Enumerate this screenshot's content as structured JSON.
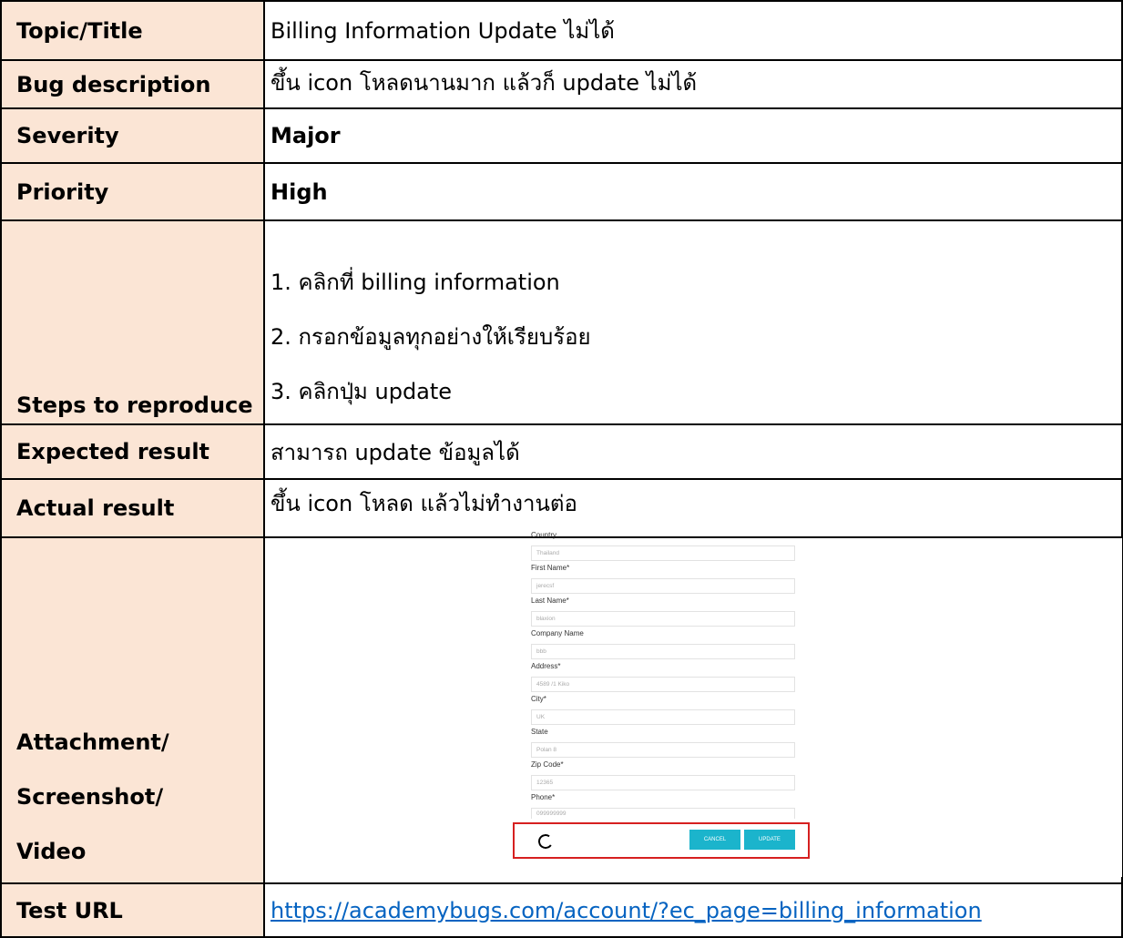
{
  "report": {
    "topic": {
      "label": "Topic/Title",
      "value": "Billing Information Update ไม่ได้"
    },
    "description": {
      "label": "Bug description",
      "value": "ขึ้น icon โหลดนานมาก แล้วก็ update ไม่ได้"
    },
    "severity": {
      "label": "Severity",
      "value": "Major"
    },
    "priority": {
      "label": "Priority",
      "value": "High"
    },
    "steps": {
      "label": "Steps to reproduce",
      "items": [
        "1. คลิกที่ billing information",
        "2. กรอกข้อมูลทุกอย่างให้เรียบร้อย",
        "3. คลิกปุ่ม update"
      ]
    },
    "expected": {
      "label": "Expected result",
      "value": "สามารถ update ข้อมูลได้"
    },
    "actual": {
      "label": "Actual result",
      "value": "ขึ้น icon โหลด แล้วไม่ทำงานต่อ"
    },
    "attachment": {
      "label_lines": [
        "Attachment/",
        "Screenshot/",
        "Video"
      ]
    },
    "test_url": {
      "label": "Test URL",
      "value": "https://academybugs.com/account/?ec_page=billing_information"
    }
  },
  "screenshot_form": {
    "fields": [
      {
        "label": "Country",
        "value": "Thailand"
      },
      {
        "label": "First Name*",
        "value": "jerecsf"
      },
      {
        "label": "Last Name*",
        "value": "blaxion"
      },
      {
        "label": "Company Name",
        "value": "bbb"
      },
      {
        "label": "Address*",
        "value": "4589 /1 Kiko"
      },
      {
        "label": "City*",
        "value": "UK"
      },
      {
        "label": "State",
        "value": "Polan 8"
      },
      {
        "label": "Zip Code*",
        "value": "12365"
      },
      {
        "label": "Phone*",
        "value": "099999999"
      }
    ],
    "cancel_label": "CANCEL",
    "update_label": "UPDATE",
    "button_color": "#1bb4cc",
    "highlight_color": "#d62020"
  }
}
